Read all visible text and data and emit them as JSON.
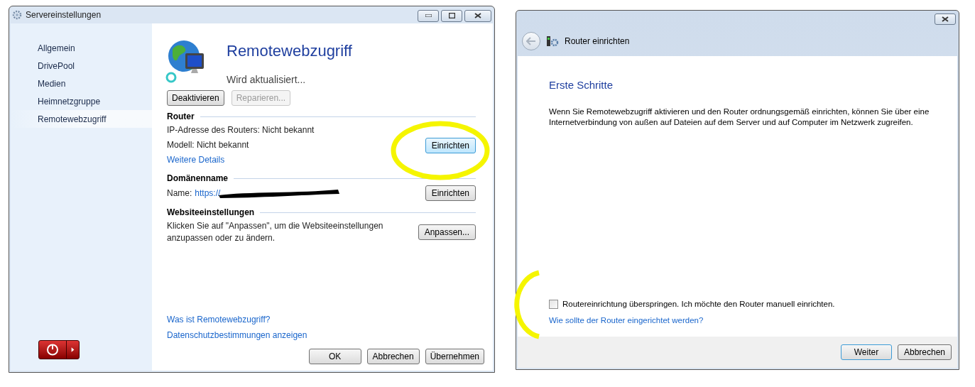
{
  "settings_window": {
    "title": "Servereinstellungen",
    "sidebar": {
      "items": [
        {
          "label": "Allgemein",
          "selected": false
        },
        {
          "label": "DrivePool",
          "selected": false
        },
        {
          "label": "Medien",
          "selected": false
        },
        {
          "label": "Heimnetzgruppe",
          "selected": false
        },
        {
          "label": "Remotewebzugriff",
          "selected": true
        }
      ]
    },
    "heading": "Remotewebzugriff",
    "status": "Wird aktualisiert...",
    "actions": [
      {
        "label": "Deaktivieren",
        "disabled": false
      },
      {
        "label": "Reparieren...",
        "disabled": true
      }
    ],
    "sections": [
      {
        "title": "Router",
        "lines": [
          {
            "kind": "text",
            "text": "IP-Adresse des Routers: Nicht bekannt"
          },
          {
            "kind": "text",
            "text": "Modell: Nicht bekannt"
          },
          {
            "kind": "link",
            "text": "Weitere Details"
          }
        ],
        "button": "Einrichten",
        "highlighted": true
      },
      {
        "title": "Domänenname",
        "lines": [
          {
            "kind": "name",
            "label": "Name:",
            "text": "https://"
          }
        ],
        "button": "Einrichten",
        "highlighted": false
      },
      {
        "title": "Websiteeinstellungen",
        "lines": [
          {
            "kind": "text",
            "text": "Klicken Sie auf \"Anpassen\", um die Websiteeinstellungen anzupassen oder zu ändern."
          }
        ],
        "button": "Anpassen...",
        "highlighted": false
      }
    ],
    "links": [
      "Was ist Remotewebzugriff?",
      "Datenschutzbestimmungen anzeigen"
    ],
    "buttons": [
      "OK",
      "Abbrechen",
      "Übernehmen"
    ]
  },
  "wizard_window": {
    "title": "Router einrichten",
    "heading": "Erste Schritte",
    "text": "Wenn Sie Remotewebzugriff aktivieren und den Router ordnungsgemäß einrichten, können Sie über eine Internetverbindung von außen auf Dateien auf dem Server und auf Computer im Netzwerk zugreifen.",
    "skip_checkbox": {
      "label": "Routereinrichtung überspringen. Ich möchte den Router manuell einrichten.",
      "checked": false
    },
    "help_link": "Wie sollte der Router eingerichtet werden?",
    "buttons": [
      {
        "label": "Weiter",
        "default": true
      },
      {
        "label": "Abbrechen",
        "default": false
      }
    ]
  }
}
